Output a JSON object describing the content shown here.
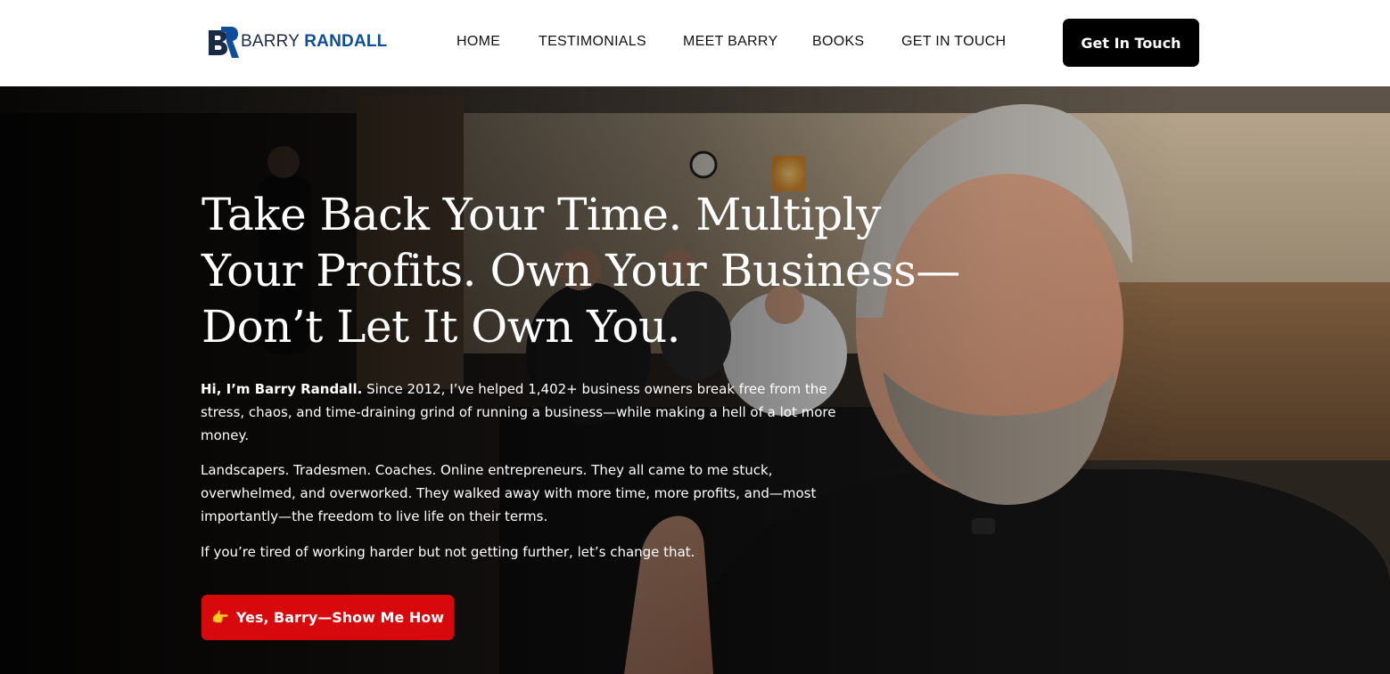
{
  "brand": {
    "first_name": "BARRY",
    "last_name": "RANDALL",
    "logo_icon": "br-monogram-icon",
    "colors": {
      "navy": "#1b2a44",
      "blue": "#0f4c9a"
    }
  },
  "nav": {
    "items": [
      {
        "label": "HOME"
      },
      {
        "label": "TESTIMONIALS"
      },
      {
        "label": "MEET BARRY"
      },
      {
        "label": "BOOKS"
      },
      {
        "label": "GET IN TOUCH"
      }
    ],
    "cta_label": "Get In Touch"
  },
  "hero": {
    "headline": "Take Back Your Time. Multiply Your Profits. Own Your Business—Don’t Let It Own You.",
    "intro_bold": "Hi, I’m Barry Randall.",
    "intro_rest": " Since 2012, I’ve helped 1,402+ business owners break free from the stress, chaos, and time-draining grind of running a business—while making a hell of a lot more money.",
    "paragraph_2": "Landscapers. Tradesmen. Coaches. Online entrepreneurs. They all came to me stuck, overwhelmed, and overworked. They walked away with more time, more profits, and—most importantly—the freedom to live life on their terms.",
    "paragraph_3": "If you’re tired of working harder but not getting further, let’s change that.",
    "cta_icon": "pointing-hand-icon",
    "cta_label": "Yes, Barry—Show Me How",
    "colors": {
      "cta": "#d7090d",
      "text": "#ffffff"
    }
  }
}
